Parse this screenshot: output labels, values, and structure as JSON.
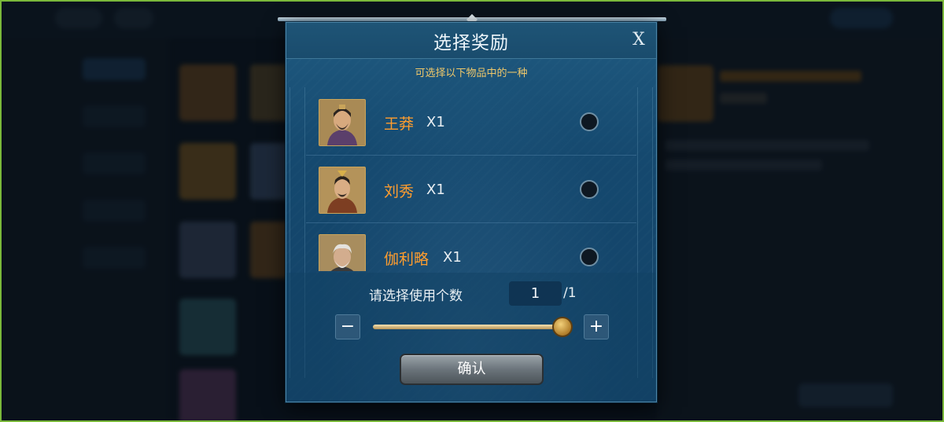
{
  "dialog": {
    "title": "选择奖励",
    "close_label": "X",
    "subtitle": "可选择以下物品中的一种"
  },
  "rewards": [
    {
      "name": "王莽",
      "quantity": "X1",
      "selected": false,
      "portrait_icon": "general-portrait-icon"
    },
    {
      "name": "刘秀",
      "quantity": "X1",
      "selected": false,
      "portrait_icon": "general-portrait-icon"
    },
    {
      "name": "伽利略",
      "quantity": "X1",
      "selected": false,
      "portrait_icon": "scholar-portrait-icon"
    }
  ],
  "usage": {
    "label": "请选择使用个数",
    "value": "1",
    "max": "/1",
    "slider_fraction": 1.0,
    "minus_label": "−",
    "plus_label": "+"
  },
  "confirm_label": "确认",
  "colors": {
    "name": "#ff9d2e",
    "subtitle": "#f0c86a",
    "panel": "#15496f"
  }
}
